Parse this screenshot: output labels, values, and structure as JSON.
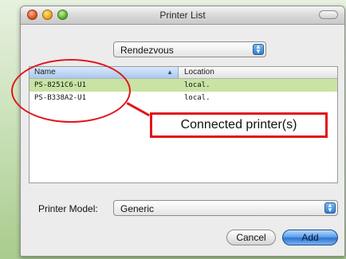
{
  "window": {
    "title": "Printer List"
  },
  "browser": {
    "selected": "Rendezvous"
  },
  "printer_list": {
    "columns": [
      "Name",
      "Location"
    ],
    "rows": [
      {
        "name": "PS-8251C6-U1",
        "location": "local.",
        "selected": true
      },
      {
        "name": "PS-B338A2-U1",
        "location": "local.",
        "selected": false
      }
    ]
  },
  "model": {
    "label": "Printer Model:",
    "selected": "Generic"
  },
  "buttons": {
    "cancel": "Cancel",
    "add": "Add"
  },
  "annotation": {
    "text": "Connected printer(s)",
    "color": "#e1151a"
  },
  "colors": {
    "selection": "#c8e3a4",
    "accent": "#2f73d2"
  },
  "icons": {
    "sort": "sort-ascending-icon",
    "popup": "popup-arrows-icon"
  }
}
